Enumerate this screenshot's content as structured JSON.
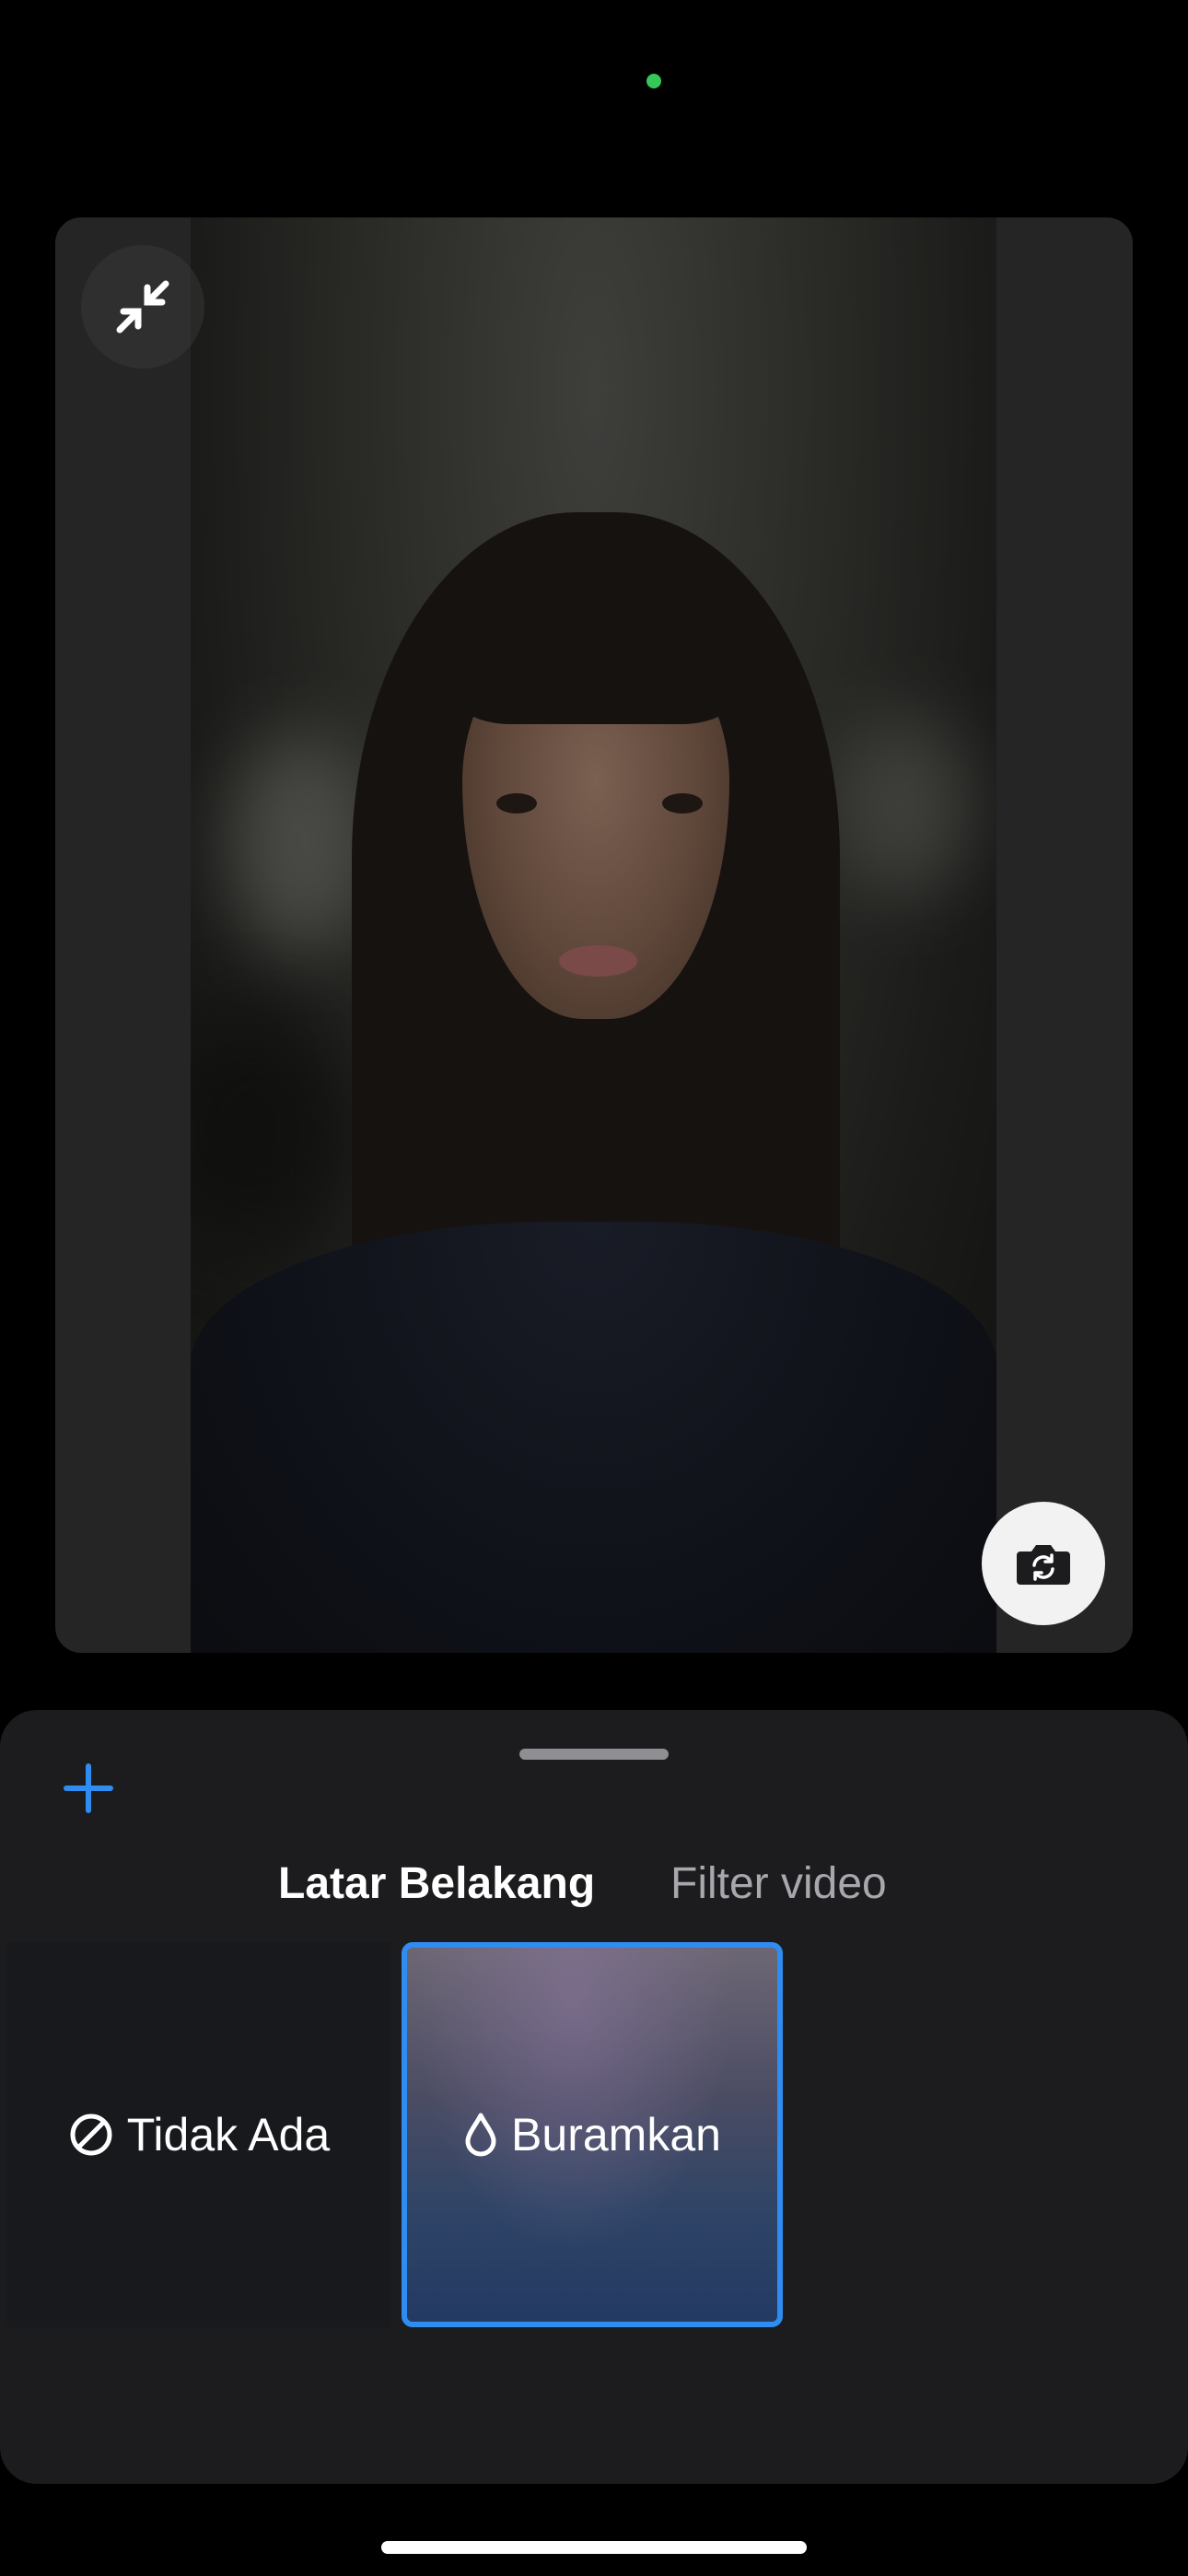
{
  "tabs": [
    {
      "label": "Latar Belakang",
      "active": true
    },
    {
      "label": "Filter video",
      "active": false
    }
  ],
  "backgrounds": [
    {
      "label": "Tidak Ada",
      "icon": "no-symbol-icon",
      "selected": false
    },
    {
      "label": "Buramkan",
      "icon": "drop-icon",
      "selected": true
    }
  ],
  "colors": {
    "accent": "#2f8cf0",
    "sheet": "#1c1c1e",
    "camera_indicator": "#34c759"
  },
  "icons": {
    "collapse": "collapse-arrows-icon",
    "flip_camera": "camera-rotate-icon",
    "add": "plus-icon"
  }
}
